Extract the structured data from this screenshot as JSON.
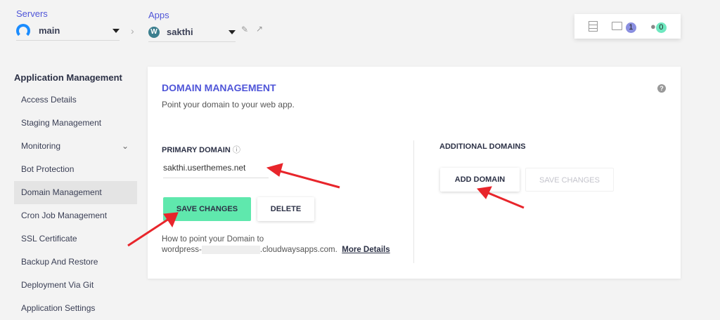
{
  "header": {
    "servers_label": "Servers",
    "server_name": "main",
    "apps_label": "Apps",
    "app_name": "sakthi",
    "folder_count": "1",
    "user_count": "0"
  },
  "sidebar": {
    "title": "Application Management",
    "items": [
      "Access Details",
      "Staging Management",
      "Monitoring",
      "Bot Protection",
      "Domain Management",
      "Cron Job Management",
      "SSL Certificate",
      "Backup And Restore",
      "Deployment Via Git",
      "Application Settings"
    ]
  },
  "main": {
    "title": "DOMAIN MANAGEMENT",
    "subtitle": "Point your domain to your web app.",
    "primary_label": "PRIMARY DOMAIN",
    "primary_value": "sakthi.userthemes.net",
    "save_label": "SAVE CHANGES",
    "delete_label": "DELETE",
    "help_line1": "How to point your Domain to",
    "help_prefix": "wordpress-",
    "help_suffix": ".cloudwaysapps.com.",
    "more_details": "More Details",
    "additional_label": "ADDITIONAL DOMAINS",
    "add_domain": "ADD DOMAIN",
    "save_changes_disabled": "SAVE CHANGES"
  },
  "colors": {
    "accent": "#4f55d8",
    "green": "#5fe8ad",
    "arrow": "#e8252b"
  }
}
